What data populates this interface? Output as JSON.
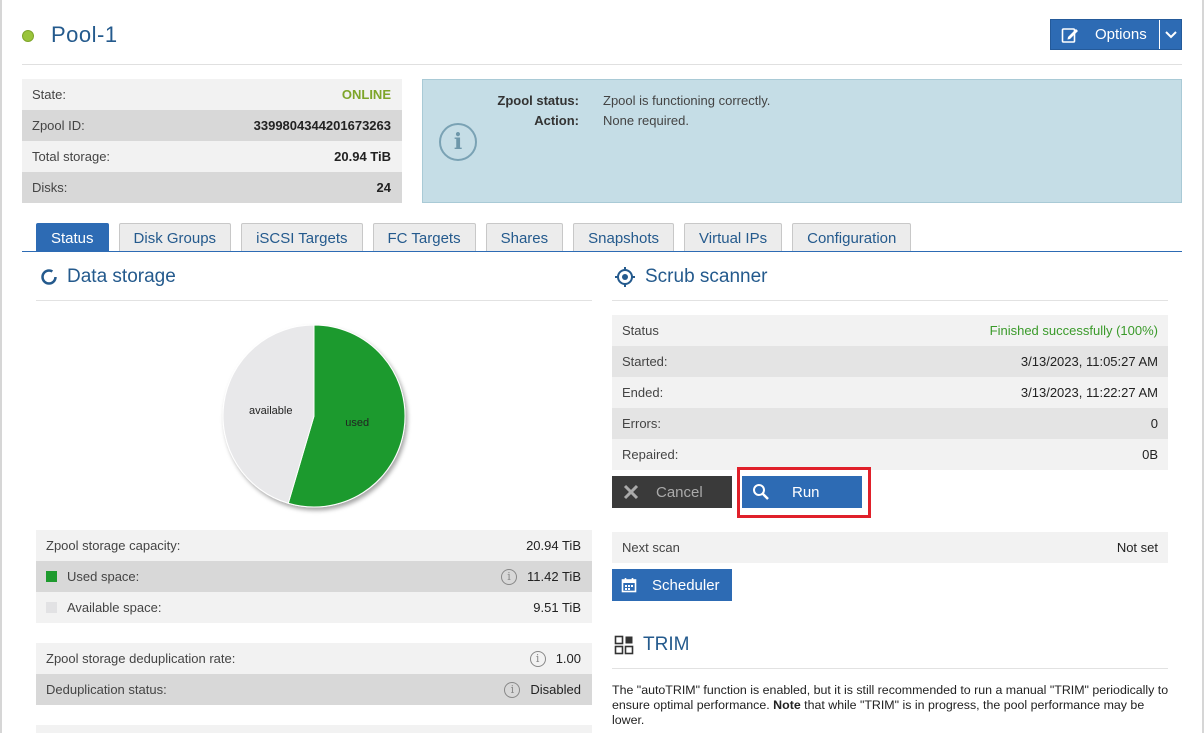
{
  "header": {
    "pool_name": "Pool-1",
    "options_label": "Options"
  },
  "pool_info": [
    {
      "label": "State:",
      "value": "ONLINE"
    },
    {
      "label": "Zpool ID:",
      "value": "3399804344201673263"
    },
    {
      "label": "Total storage:",
      "value": "20.94 TiB"
    },
    {
      "label": "Disks:",
      "value": "24"
    }
  ],
  "status_panel": {
    "zpool_status_label": "Zpool status:",
    "zpool_status_value": "Zpool is functioning correctly.",
    "action_label": "Action:",
    "action_value": "None required."
  },
  "tabs": [
    "Status",
    "Disk Groups",
    "iSCSI Targets",
    "FC Targets",
    "Shares",
    "Snapshots",
    "Virtual IPs",
    "Configuration"
  ],
  "active_tab": "Status",
  "data_storage": {
    "title": "Data storage",
    "rows": [
      {
        "label": "Zpool storage capacity:",
        "value": "20.94 TiB"
      },
      {
        "label": "Used space:",
        "value": "11.42 TiB"
      },
      {
        "label": "Available space:",
        "value": "9.51 TiB"
      }
    ],
    "dedup_rows": [
      {
        "label": "Zpool storage deduplication rate:",
        "value": "1.00"
      },
      {
        "label": "Deduplication status:",
        "value": "Disabled"
      }
    ]
  },
  "chart_data": {
    "type": "pie",
    "slices": [
      {
        "label": "used",
        "value": 11.42,
        "color": "#1e9a2e"
      },
      {
        "label": "available",
        "value": 9.51,
        "color": "#e8e8ea"
      }
    ]
  },
  "scrub": {
    "title": "Scrub scanner",
    "rows": [
      {
        "label": "Status",
        "value": "Finished successfully (100%)"
      },
      {
        "label": "Started:",
        "value": "3/13/2023, 11:05:27 AM"
      },
      {
        "label": "Ended:",
        "value": "3/13/2023, 11:22:27 AM"
      },
      {
        "label": "Errors:",
        "value": "0"
      },
      {
        "label": "Repaired:",
        "value": "0B"
      }
    ],
    "cancel_label": "Cancel",
    "run_label": "Run",
    "next_scan_label": "Next scan",
    "next_scan_value": "Not set",
    "scheduler_label": "Scheduler"
  },
  "trim": {
    "title": "TRIM",
    "text_1": "The \"autoTRIM\" function is enabled, but it is still recommended to run a manual \"TRIM\" periodically to ensure optimal performance. ",
    "text_bold": "Note",
    "text_2": " that while \"TRIM\" is in progress, the pool performance may be lower."
  },
  "colors": {
    "accent": "#2d6bb4",
    "online": "#7ea52a",
    "success": "#3a9a2a",
    "used": "#1e9a2e",
    "highlight": "#e0202a"
  }
}
